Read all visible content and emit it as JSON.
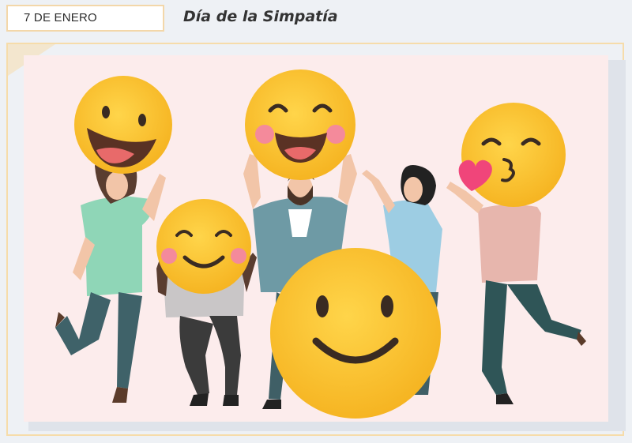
{
  "header": {
    "date": "7 DE ENERO",
    "title": "Día de la Simpatía"
  },
  "colors": {
    "emoji_yellow": "#fbc02d",
    "panel_bg": "#fcecec",
    "frame_border": "#f6dcaa",
    "heart": "#f0457a"
  },
  "illustration": {
    "figures": [
      "laughing-face-person",
      "laughing-face-person-center",
      "blushing-smile-person-sitting",
      "big-smile-emoji",
      "waving-woman",
      "kissing-face-person"
    ]
  }
}
